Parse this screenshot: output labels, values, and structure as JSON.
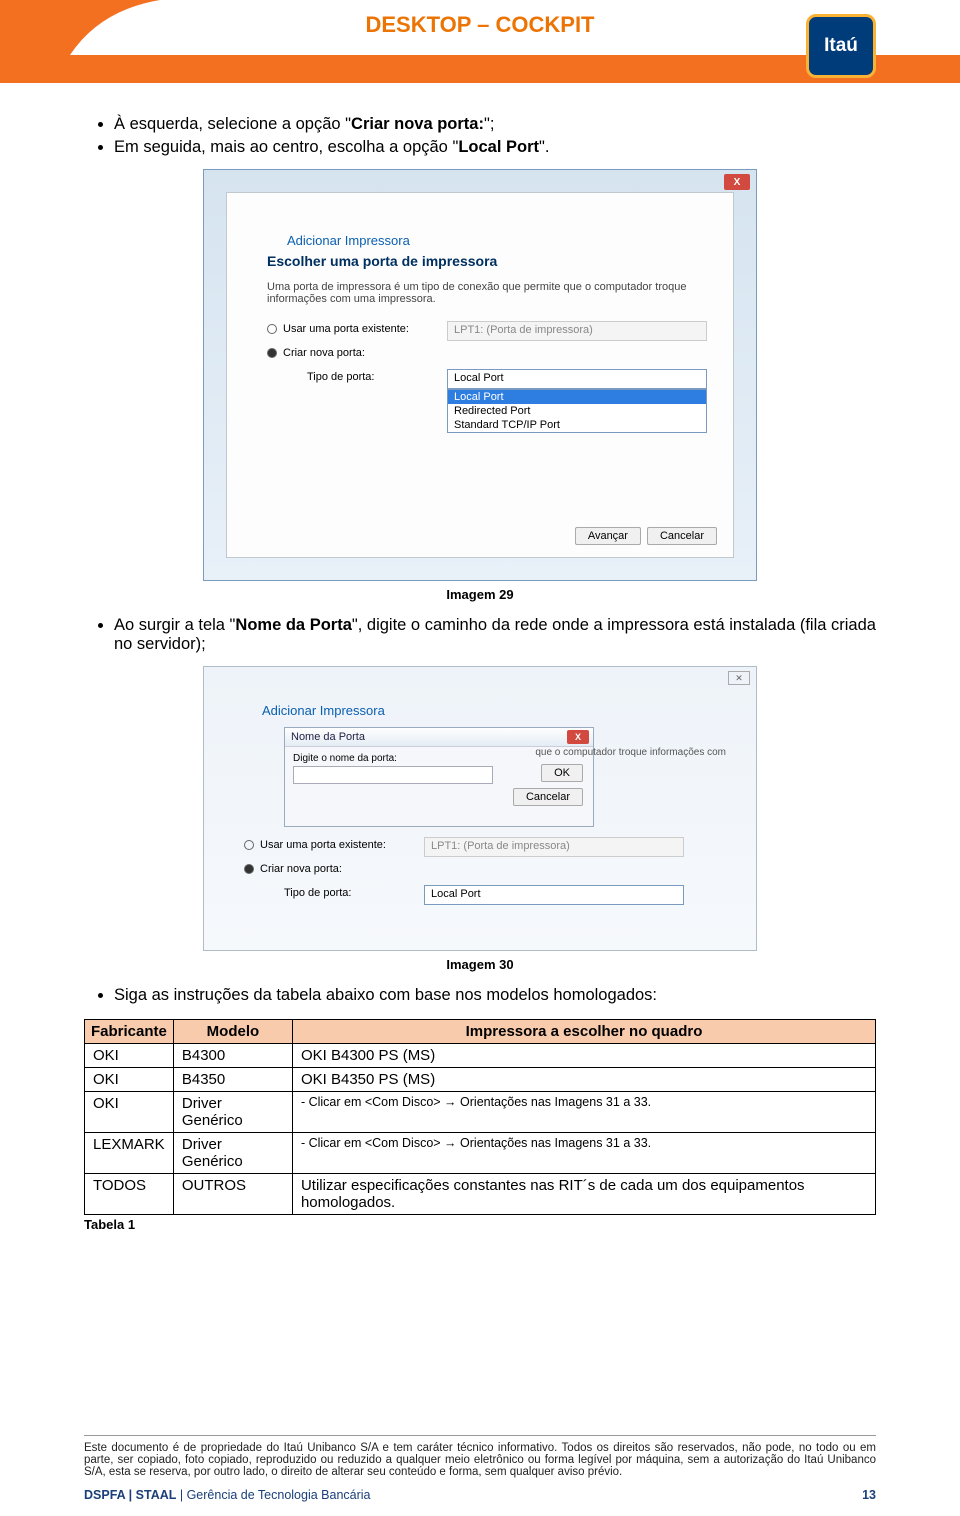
{
  "header": {
    "title": "DESKTOP – COCKPIT",
    "logo_text": "Itaú"
  },
  "intro_bullets": [
    {
      "pre": "À esquerda, selecione a opção \"",
      "b": "Criar nova porta:",
      "post": "\";"
    },
    {
      "pre": "Em seguida, mais ao centro, escolha a opção \"",
      "b": "Local Port",
      "post": "\"."
    }
  ],
  "screenshot1": {
    "win_title": "Adicionar Impressora",
    "heading": "Escolher uma porta de impressora",
    "desc": "Uma porta de impressora é um tipo de conexão que permite que o computador troque informações com uma impressora.",
    "opt_existing": "Usar uma porta existente:",
    "lpt": "LPT1: (Porta de impressora)",
    "opt_new": "Criar nova porta:",
    "type_label": "Tipo de porta:",
    "combo_value": "Local Port",
    "drop_sel": "Local Port",
    "drop_opt1": "Redirected Port",
    "drop_opt2": "Standard TCP/IP Port",
    "btn_next": "Avançar",
    "btn_cancel": "Cancelar",
    "close_x": "X"
  },
  "caption1": "Imagem 29",
  "mid_bullet": {
    "pre": "Ao surgir a tela \"",
    "b": "Nome da Porta",
    "post": "\", digite o caminho da rede onde a impressora está instalada (fila criada no servidor);"
  },
  "screenshot2": {
    "win_title": "Adicionar Impressora",
    "modal_title": "Nome da Porta",
    "modal_label": "Digite o nome da porta:",
    "ok": "OK",
    "cancel": "Cancelar",
    "side_text": "que o computador troque informações com",
    "opt_existing": "Usar uma porta existente:",
    "lpt": "LPT1: (Porta de impressora)",
    "opt_new": "Criar nova porta:",
    "type_label": "Tipo de porta:",
    "combo_value": "Local Port",
    "close_x": "X",
    "top_x": "✕"
  },
  "caption2": "Imagem 30",
  "bullet3": "Siga as instruções da tabela abaixo com base nos modelos homologados:",
  "table": {
    "head": {
      "c1": "Fabricante",
      "c2": "Modelo",
      "c3": "Impressora a escolher no quadro"
    },
    "rows": [
      {
        "c1": "OKI",
        "c2": "B4300",
        "c3": "OKI B4300 PS (MS)"
      },
      {
        "c1": "OKI",
        "c2": "B4350",
        "c3": "OKI B4350 PS (MS)"
      },
      {
        "c1": "OKI",
        "c2": "Driver Genérico",
        "c3": "- Clicar em <Com Disco> → Orientações nas Imagens 31 a 33."
      },
      {
        "c1": "LEXMARK",
        "c2": "Driver Genérico",
        "c3": "- Clicar em <Com Disco> → Orientações nas Imagens 31 a 33."
      },
      {
        "c1": "TODOS",
        "c2": "OUTROS",
        "c3": "Utilizar especificações constantes nas RIT´s de cada um dos equipamentos homologados."
      }
    ],
    "label": "Tabela 1"
  },
  "footer": {
    "disclaimer": "Este documento é de propriedade do Itaú Unibanco S/A e tem caráter técnico informativo. Todos os direitos são reservados, não pode, no todo ou em parte, ser copiado, foto copiado, reproduzido ou reduzido a qualquer meio eletrônico ou forma legível por máquina, sem a autorização do Itaú Unibanco S/A, esta se reserva, por outro lado, o direito de alterar seu conteúdo e forma, sem qualquer aviso prévio.",
    "line_left_b": "DSPFA | STAAL",
    "line_left_rest": " | Gerência de Tecnologia Bancária",
    "page": "13"
  }
}
